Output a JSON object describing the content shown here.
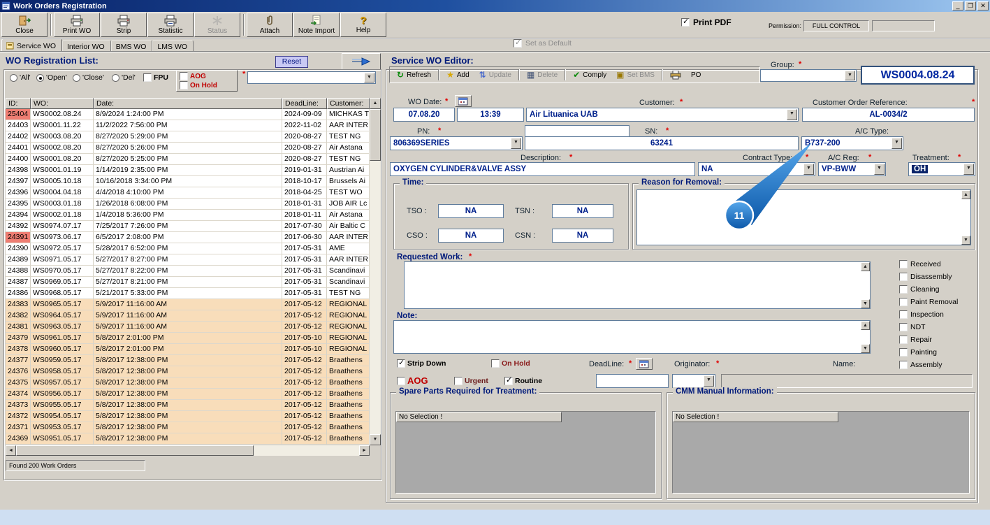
{
  "ui": {
    "required_marker": "*"
  },
  "window": {
    "title": "Work Orders Registration"
  },
  "toolbar": {
    "buttons": [
      {
        "label": "Close"
      },
      {
        "label": "Print WO"
      },
      {
        "label": "Strip"
      },
      {
        "label": "Statistic"
      },
      {
        "label": "Status",
        "disabled": true
      },
      {
        "label": "Attach"
      },
      {
        "label": "Note Import"
      },
      {
        "label": "Help"
      }
    ],
    "print_pdf": {
      "label": "Print PDF",
      "checked": true
    },
    "permission": {
      "label": "Permission:",
      "value": "FULL CONTROL"
    }
  },
  "tabs": {
    "items": [
      "Service WO",
      "Interior WO",
      "BMS WO",
      "LMS WO"
    ],
    "active": "Service WO",
    "set_as_default": "Set as Default"
  },
  "wo_list": {
    "title": "WO Registration List:",
    "reset_label": "Reset",
    "filters": {
      "radios": [
        "'All'",
        "'Open'",
        "'Close'",
        "'Del'"
      ],
      "selected": "'Open'",
      "fpu": "FPU",
      "aog": "AOG",
      "on_hold": "On Hold"
    },
    "columns": [
      "ID:",
      "WO:",
      "Date:",
      "DeadLine:",
      "Customer:"
    ],
    "rows": [
      {
        "id": "25404",
        "wo": "WS0002.08.24",
        "date": "8/9/2024 1:24:00 PM",
        "deadline": "2024-09-09",
        "customer": "MICHKAS T",
        "id_red": true,
        "shade": false
      },
      {
        "id": "24403",
        "wo": "WS0001.11.22",
        "date": "11/2/2022 7:56:00 PM",
        "deadline": "2022-11-02",
        "customer": "AAR INTER",
        "id_red": false,
        "shade": false
      },
      {
        "id": "24402",
        "wo": "WS0003.08.20",
        "date": "8/27/2020 5:29:00 PM",
        "deadline": "2020-08-27",
        "customer": "TEST NG",
        "id_red": false,
        "shade": false
      },
      {
        "id": "24401",
        "wo": "WS0002.08.20",
        "date": "8/27/2020 5:26:00 PM",
        "deadline": "2020-08-27",
        "customer": "Air Astana",
        "id_red": false,
        "shade": false
      },
      {
        "id": "24400",
        "wo": "WS0001.08.20",
        "date": "8/27/2020 5:25:00 PM",
        "deadline": "2020-08-27",
        "customer": "TEST NG",
        "id_red": false,
        "shade": false
      },
      {
        "id": "24398",
        "wo": "WS0001.01.19",
        "date": "1/14/2019 2:35:00 PM",
        "deadline": "2019-01-31",
        "customer": "Austrian Ai",
        "id_red": false,
        "shade": false
      },
      {
        "id": "24397",
        "wo": "WS0005.10.18",
        "date": "10/16/2018 3:34:00 PM",
        "deadline": "2018-10-17",
        "customer": "Brussels Ai",
        "id_red": false,
        "shade": false
      },
      {
        "id": "24396",
        "wo": "WS0004.04.18",
        "date": "4/4/2018 4:10:00 PM",
        "deadline": "2018-04-25",
        "customer": "TEST WO",
        "id_red": false,
        "shade": false
      },
      {
        "id": "24395",
        "wo": "WS0003.01.18",
        "date": "1/26/2018 6:08:00 PM",
        "deadline": "2018-01-31",
        "customer": "JOB AIR Lc",
        "id_red": false,
        "shade": false
      },
      {
        "id": "24394",
        "wo": "WS0002.01.18",
        "date": "1/4/2018 5:36:00 PM",
        "deadline": "2018-01-11",
        "customer": "Air Astana",
        "id_red": false,
        "shade": false
      },
      {
        "id": "24392",
        "wo": "WS0974.07.17",
        "date": "7/25/2017 7:26:00 PM",
        "deadline": "2017-07-30",
        "customer": "Air Baltic C",
        "id_red": false,
        "shade": false
      },
      {
        "id": "24391",
        "wo": "WS0973.06.17",
        "date": "6/5/2017 2:08:00 PM",
        "deadline": "2017-06-30",
        "customer": "AAR INTER",
        "id_red": true,
        "shade": false
      },
      {
        "id": "24390",
        "wo": "WS0972.05.17",
        "date": "5/28/2017 6:52:00 PM",
        "deadline": "2017-05-31",
        "customer": "AME",
        "id_red": false,
        "shade": false
      },
      {
        "id": "24389",
        "wo": "WS0971.05.17",
        "date": "5/27/2017 8:27:00 PM",
        "deadline": "2017-05-31",
        "customer": "AAR INTER",
        "id_red": false,
        "shade": false
      },
      {
        "id": "24388",
        "wo": "WS0970.05.17",
        "date": "5/27/2017 8:22:00 PM",
        "deadline": "2017-05-31",
        "customer": "Scandinavi",
        "id_red": false,
        "shade": false
      },
      {
        "id": "24387",
        "wo": "WS0969.05.17",
        "date": "5/27/2017 8:21:00 PM",
        "deadline": "2017-05-31",
        "customer": "Scandinavi",
        "id_red": false,
        "shade": false
      },
      {
        "id": "24386",
        "wo": "WS0968.05.17",
        "date": "5/21/2017 5:33:00 PM",
        "deadline": "2017-05-31",
        "customer": "TEST NG",
        "id_red": false,
        "shade": false
      },
      {
        "id": "24383",
        "wo": "WS0965.05.17",
        "date": "5/9/2017 11:16:00 AM",
        "deadline": "2017-05-12",
        "customer": "REGIONAL",
        "id_red": false,
        "shade": true
      },
      {
        "id": "24382",
        "wo": "WS0964.05.17",
        "date": "5/9/2017 11:16:00 AM",
        "deadline": "2017-05-12",
        "customer": "REGIONAL",
        "id_red": false,
        "shade": true
      },
      {
        "id": "24381",
        "wo": "WS0963.05.17",
        "date": "5/9/2017 11:16:00 AM",
        "deadline": "2017-05-12",
        "customer": "REGIONAL",
        "id_red": false,
        "shade": true
      },
      {
        "id": "24379",
        "wo": "WS0961.05.17",
        "date": "5/8/2017 2:01:00 PM",
        "deadline": "2017-05-10",
        "customer": "REGIONAL",
        "id_red": false,
        "shade": true
      },
      {
        "id": "24378",
        "wo": "WS0960.05.17",
        "date": "5/8/2017 2:01:00 PM",
        "deadline": "2017-05-10",
        "customer": "REGIONAL",
        "id_red": false,
        "shade": true
      },
      {
        "id": "24377",
        "wo": "WS0959.05.17",
        "date": "5/8/2017 12:38:00 PM",
        "deadline": "2017-05-12",
        "customer": "Braathens",
        "id_red": false,
        "shade": true
      },
      {
        "id": "24376",
        "wo": "WS0958.05.17",
        "date": "5/8/2017 12:38:00 PM",
        "deadline": "2017-05-12",
        "customer": "Braathens",
        "id_red": false,
        "shade": true
      },
      {
        "id": "24375",
        "wo": "WS0957.05.17",
        "date": "5/8/2017 12:38:00 PM",
        "deadline": "2017-05-12",
        "customer": "Braathens",
        "id_red": false,
        "shade": true
      },
      {
        "id": "24374",
        "wo": "WS0956.05.17",
        "date": "5/8/2017 12:38:00 PM",
        "deadline": "2017-05-12",
        "customer": "Braathens",
        "id_red": false,
        "shade": true
      },
      {
        "id": "24373",
        "wo": "WS0955.05.17",
        "date": "5/8/2017 12:38:00 PM",
        "deadline": "2017-05-12",
        "customer": "Braathens",
        "id_red": false,
        "shade": true
      },
      {
        "id": "24372",
        "wo": "WS0954.05.17",
        "date": "5/8/2017 12:38:00 PM",
        "deadline": "2017-05-12",
        "customer": "Braathens",
        "id_red": false,
        "shade": true
      },
      {
        "id": "24371",
        "wo": "WS0953.05.17",
        "date": "5/8/2017 12:38:00 PM",
        "deadline": "2017-05-12",
        "customer": "Braathens",
        "id_red": false,
        "shade": true
      },
      {
        "id": "24369",
        "wo": "WS0951.05.17",
        "date": "5/8/2017 12:38:00 PM",
        "deadline": "2017-05-12",
        "customer": "Braathens",
        "id_red": false,
        "shade": true
      }
    ],
    "status": "Found 200 Work Orders"
  },
  "editor": {
    "title": "Service WO Editor:",
    "toolbar": {
      "refresh": "Refresh",
      "add": "Add",
      "update": "Update",
      "delete": "Delete",
      "comply": "Comply",
      "set_bms": "Set BMS",
      "po": "PO"
    },
    "group_label": "Group:",
    "wo_number": "WS0004.08.24",
    "fields": {
      "wo_date_label": "WO Date:",
      "wo_date": "07.08.20",
      "wo_time": "13:39",
      "customer_label": "Customer:",
      "customer": "Air Lituanica UAB",
      "cor_label": "Customer Order Reference:",
      "cor": "AL-0034/2",
      "pn_label": "PN:",
      "pn": "806369SERIES",
      "sn_label": "SN:",
      "sn": "63241",
      "actype_label": "A/C Type:",
      "actype": "B737-200",
      "desc_label": "Description:",
      "desc": "OXYGEN CYLINDER&VALVE ASSY",
      "contract_label": "Contract Type:",
      "contract": "NA",
      "acreg_label": "A/C Reg:",
      "acreg": "VP-BWW",
      "treatment_label": "Treatment:",
      "treatment": "OH"
    },
    "time": {
      "title": "Time:",
      "tso_label": "TSO :",
      "tso": "NA",
      "tsn_label": "TSN :",
      "tsn": "NA",
      "cso_label": "CSO :",
      "cso": "NA",
      "csn_label": "CSN :",
      "csn": "NA"
    },
    "reason_label": "Reason for Removal:",
    "requested_label": "Requested Work:",
    "note_label": "Note:",
    "treatment_checks": [
      "Received",
      "Disassembly",
      "Cleaning",
      "Paint Removal",
      "Inspection",
      "NDT",
      "Repair",
      "Painting",
      "Assembly"
    ],
    "flags": {
      "strip_down": "Strip Down",
      "on_hold": "On Hold",
      "aog": "AOG",
      "urgent": "Urgent",
      "routine": "Routine"
    },
    "deadline_label": "DeadLine:",
    "originator_label": "Originator:",
    "name_label": "Name:",
    "spare": {
      "title": "Spare Parts Required for Treatment:",
      "header": "No Selection !"
    },
    "cmm": {
      "title": "CMM Manual Information:",
      "header": "No Selection !"
    },
    "callout": "11"
  }
}
